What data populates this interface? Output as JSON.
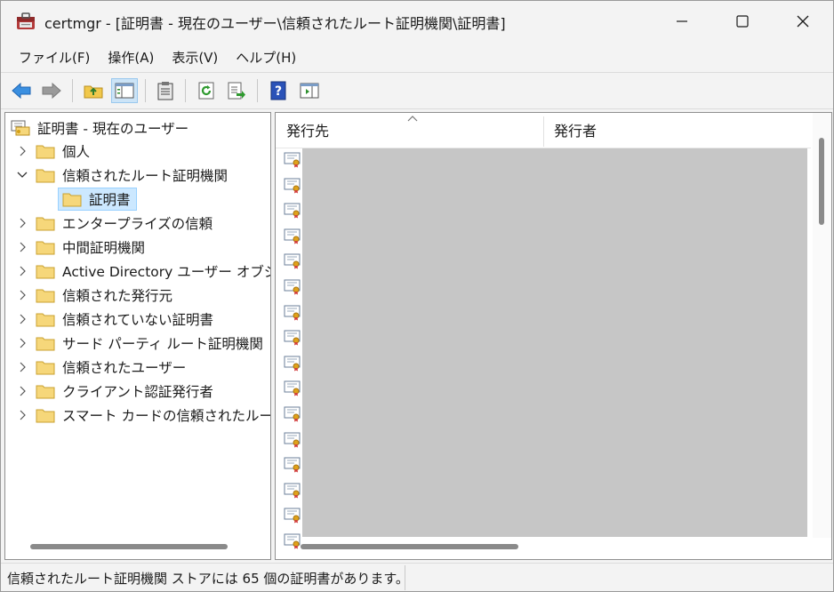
{
  "window": {
    "title": "certmgr - [証明書 - 現在のユーザー\\信頼されたルート証明機関\\証明書]"
  },
  "menu": {
    "items": [
      "ファイル(F)",
      "操作(A)",
      "表示(V)",
      "ヘルプ(H)"
    ]
  },
  "tree": {
    "root": "証明書 - 現在のユーザー",
    "items": [
      {
        "label": "個人",
        "expanded": false
      },
      {
        "label": "信頼されたルート証明機関",
        "expanded": true
      },
      {
        "label": "証明書",
        "selected": true,
        "child": true
      },
      {
        "label": "エンタープライズの信頼",
        "expanded": false
      },
      {
        "label": "中間証明機関",
        "expanded": false
      },
      {
        "label": "Active Directory ユーザー オブジェクト",
        "expanded": false
      },
      {
        "label": "信頼された発行元",
        "expanded": false
      },
      {
        "label": "信頼されていない証明書",
        "expanded": false
      },
      {
        "label": "サード パーティ ルート証明機関",
        "expanded": false
      },
      {
        "label": "信頼されたユーザー",
        "expanded": false
      },
      {
        "label": "クライアント認証発行者",
        "expanded": false
      },
      {
        "label": "スマート カードの信頼されたルート",
        "expanded": false
      }
    ]
  },
  "list": {
    "columns": [
      "発行先",
      "発行者"
    ],
    "visible_row_count": 17
  },
  "status": {
    "text": "信頼されたルート証明機関 ストアには 65 個の証明書があります。"
  },
  "colors": {
    "selection": "#cce8ff",
    "redaction": "#c6c6c6",
    "folder": "#f6d77a"
  }
}
